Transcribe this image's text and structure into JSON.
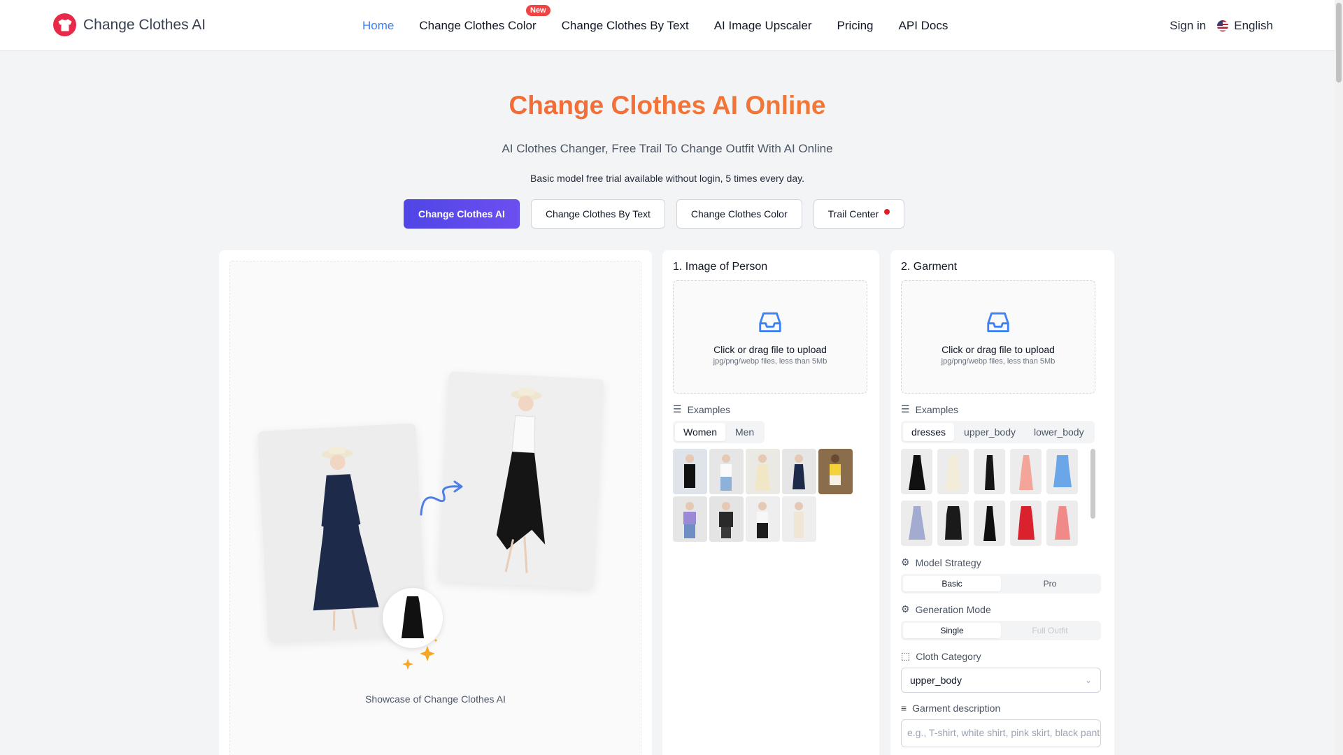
{
  "header": {
    "logo_text": "Change Clothes AI",
    "nav": [
      {
        "label": "Home",
        "active": true
      },
      {
        "label": "Change Clothes Color",
        "badge": "New"
      },
      {
        "label": "Change Clothes By Text"
      },
      {
        "label": "AI Image Upscaler"
      },
      {
        "label": "Pricing"
      },
      {
        "label": "API Docs"
      }
    ],
    "sign_in": "Sign in",
    "language": "English"
  },
  "hero": {
    "title": "Change Clothes AI Online",
    "subtitle": "AI Clothes Changer, Free Trail To Change Outfit With AI Online",
    "note": "Basic model free trial available without login, 5 times every day."
  },
  "tabs": [
    "Change Clothes AI",
    "Change Clothes By Text",
    "Change Clothes Color",
    "Trail Center"
  ],
  "showcase": {
    "caption": "Showcase of Change Clothes AI"
  },
  "person": {
    "title": "1. Image of Person",
    "upload_text": "Click or drag file to upload",
    "upload_hint": "jpg/png/webp files, less than 5Mb",
    "examples_label": "Examples",
    "example_tabs": [
      "Women",
      "Men"
    ]
  },
  "garment": {
    "title": "2. Garment",
    "upload_text": "Click or drag file to upload",
    "upload_hint": "jpg/png/webp files, less than 5Mb",
    "examples_label": "Examples",
    "example_tabs": [
      "dresses",
      "upper_body",
      "lower_body"
    ],
    "model_strategy_label": "Model Strategy",
    "model_strategy_options": [
      "Basic",
      "Pro"
    ],
    "generation_mode_label": "Generation Mode",
    "generation_mode_options": [
      "Single",
      "Full Outfit"
    ],
    "cloth_category_label": "Cloth Category",
    "cloth_category_value": "upper_body",
    "garment_description_label": "Garment description",
    "garment_description_placeholder": "e.g., T-shirt, white shirt, pink skirt, black pants"
  },
  "colors": {
    "accent": "#3b82f6",
    "brand": "#e8294a",
    "primary_button": "#4f46e5",
    "title_gradient_start": "#ef5a3c",
    "title_gradient_end": "#f58a32"
  },
  "icons": {
    "logo": "tshirt-icon",
    "upload": "inbox-icon",
    "examples": "list-icon",
    "settings": "gear-icon",
    "category": "tag-icon",
    "dropdown": "chevron-down-icon"
  }
}
